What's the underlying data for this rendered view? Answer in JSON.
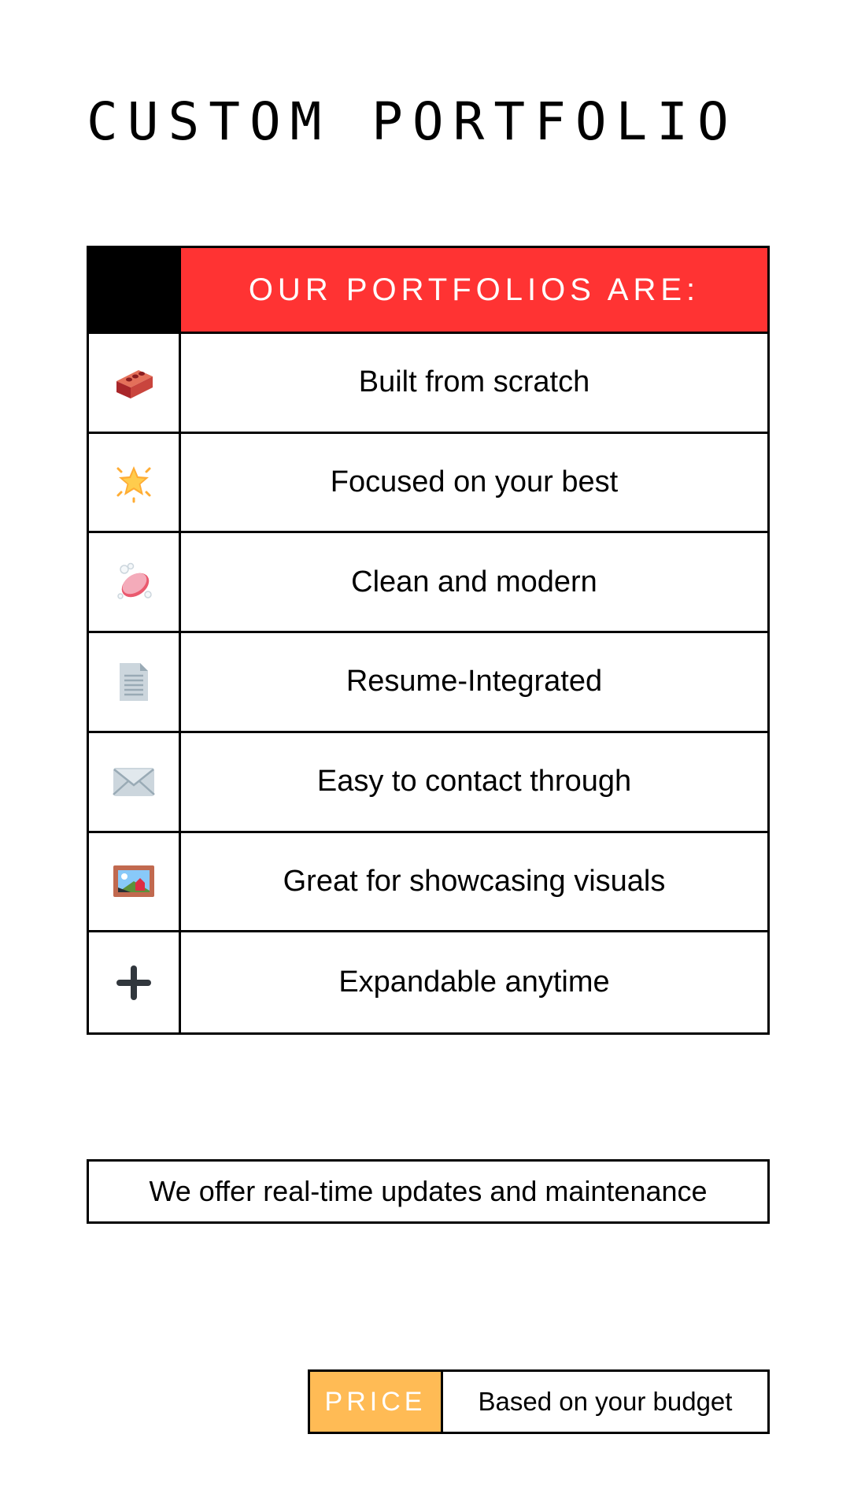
{
  "title": "CUSTOM PORTFOLIO",
  "features": {
    "header": "OUR PORTFOLIOS ARE:",
    "items": [
      {
        "icon": "brick-icon",
        "label": "Built from scratch"
      },
      {
        "icon": "glowing-star-icon",
        "label": "Focused on your best"
      },
      {
        "icon": "soap-icon",
        "label": "Clean and modern"
      },
      {
        "icon": "document-icon",
        "label": "Resume-Integrated"
      },
      {
        "icon": "envelope-icon",
        "label": "Easy to contact through"
      },
      {
        "icon": "framed-picture-icon",
        "label": "Great for showcasing visuals"
      },
      {
        "icon": "plus-icon",
        "label": "Expandable anytime"
      }
    ]
  },
  "note": "We offer real-time updates and maintenance",
  "price": {
    "label": "PRICE",
    "value": "Based on your budget"
  },
  "colors": {
    "header_red": "#ff3333",
    "price_orange": "#ffbb55",
    "border": "#000000"
  }
}
